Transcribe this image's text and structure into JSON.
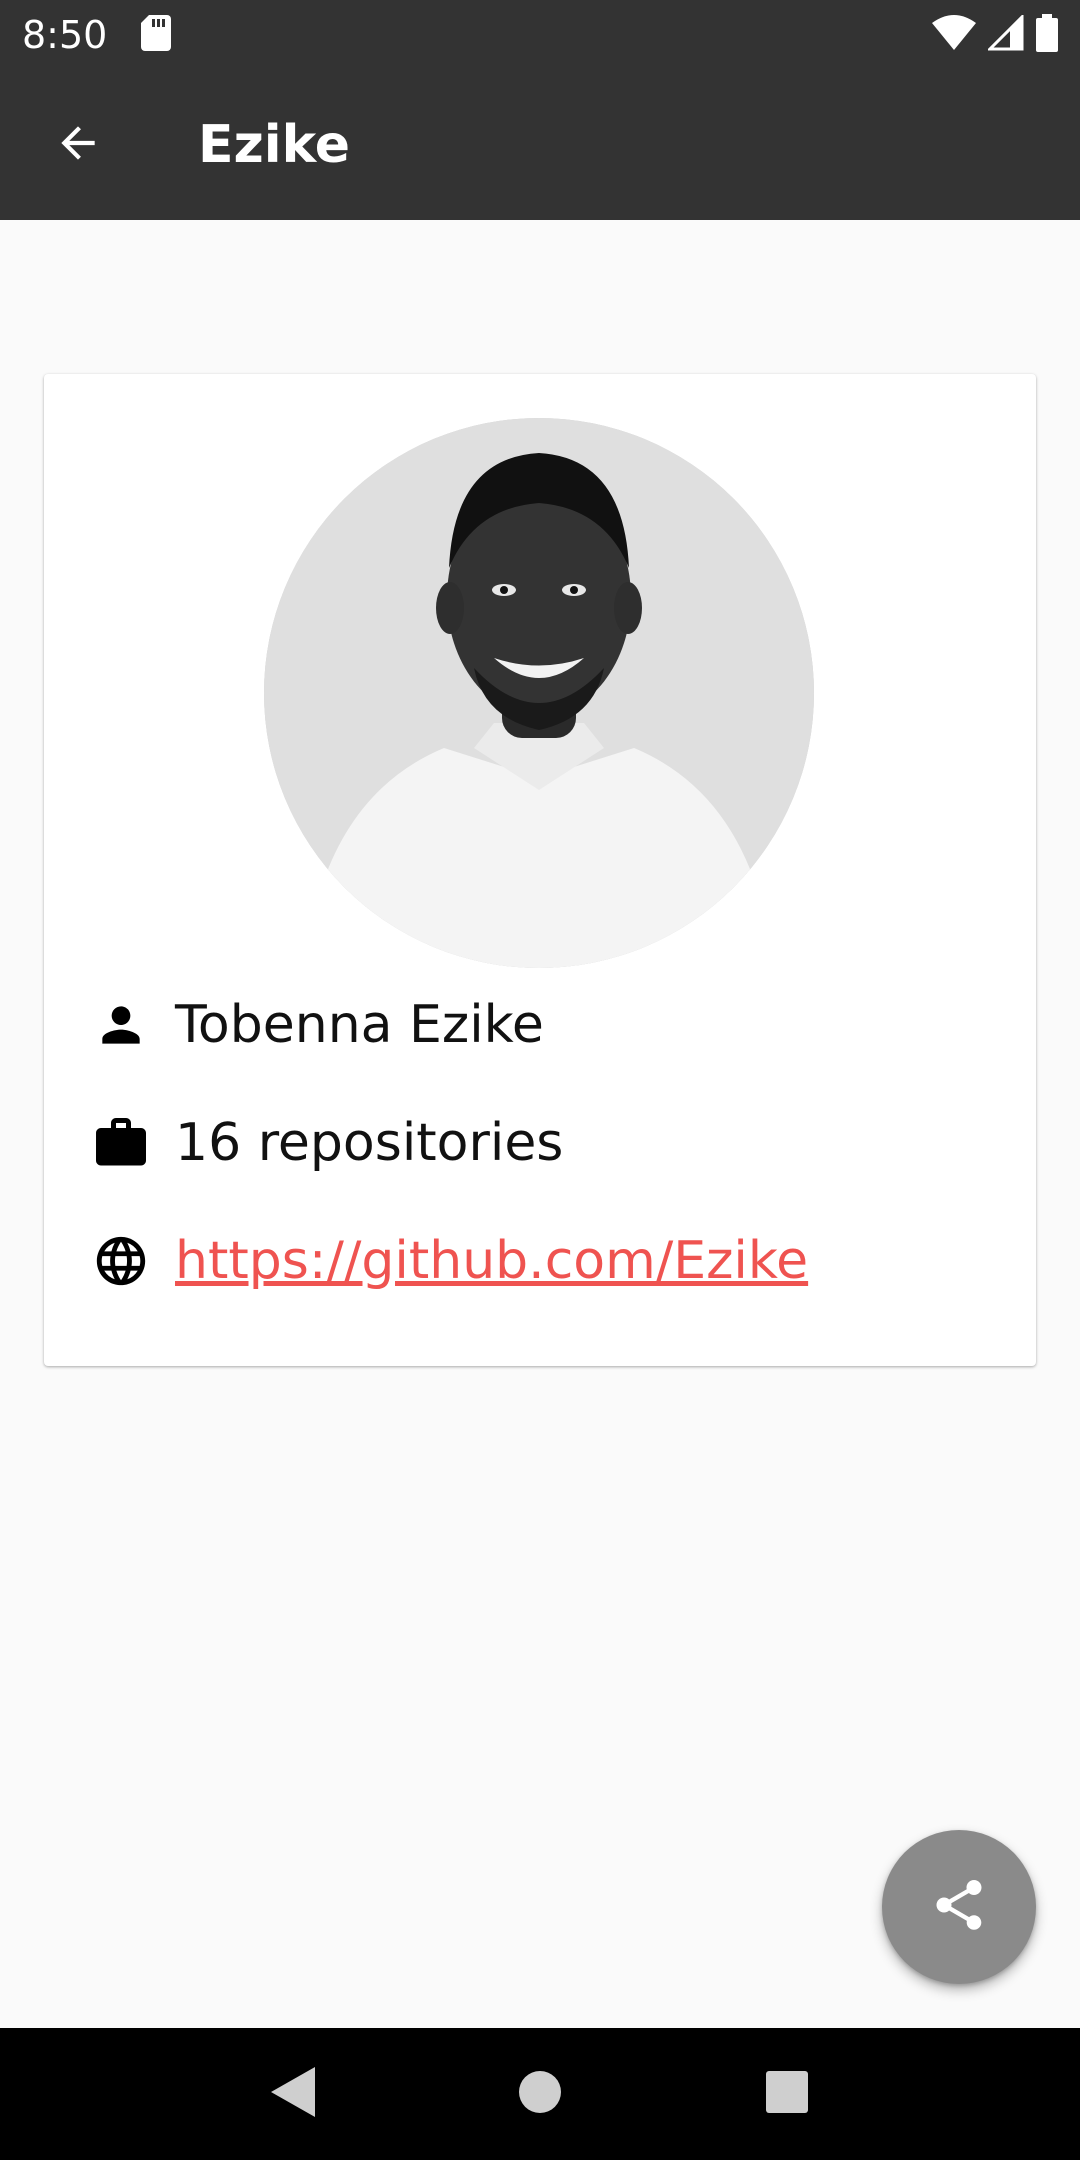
{
  "status_bar": {
    "time": "8:50",
    "icons": [
      "sd-card-icon",
      "wifi-icon",
      "signal-icon",
      "battery-icon"
    ]
  },
  "app_bar": {
    "title": "Ezike",
    "back_icon": "arrow-back-icon"
  },
  "profile": {
    "name": "Tobenna Ezike",
    "repositories": "16 repositories",
    "url": "https://github.com/Ezike",
    "icons": {
      "name": "person-icon",
      "repositories": "briefcase-icon",
      "url": "globe-icon"
    }
  },
  "fab": {
    "icon": "share-icon"
  },
  "nav": {
    "icons": [
      "back-triangle-icon",
      "home-circle-icon",
      "recents-square-icon"
    ]
  },
  "colors": {
    "app_bar": "#333333",
    "background": "#fafafa",
    "link": "#ef5350",
    "fab": "#8a8a8a"
  }
}
